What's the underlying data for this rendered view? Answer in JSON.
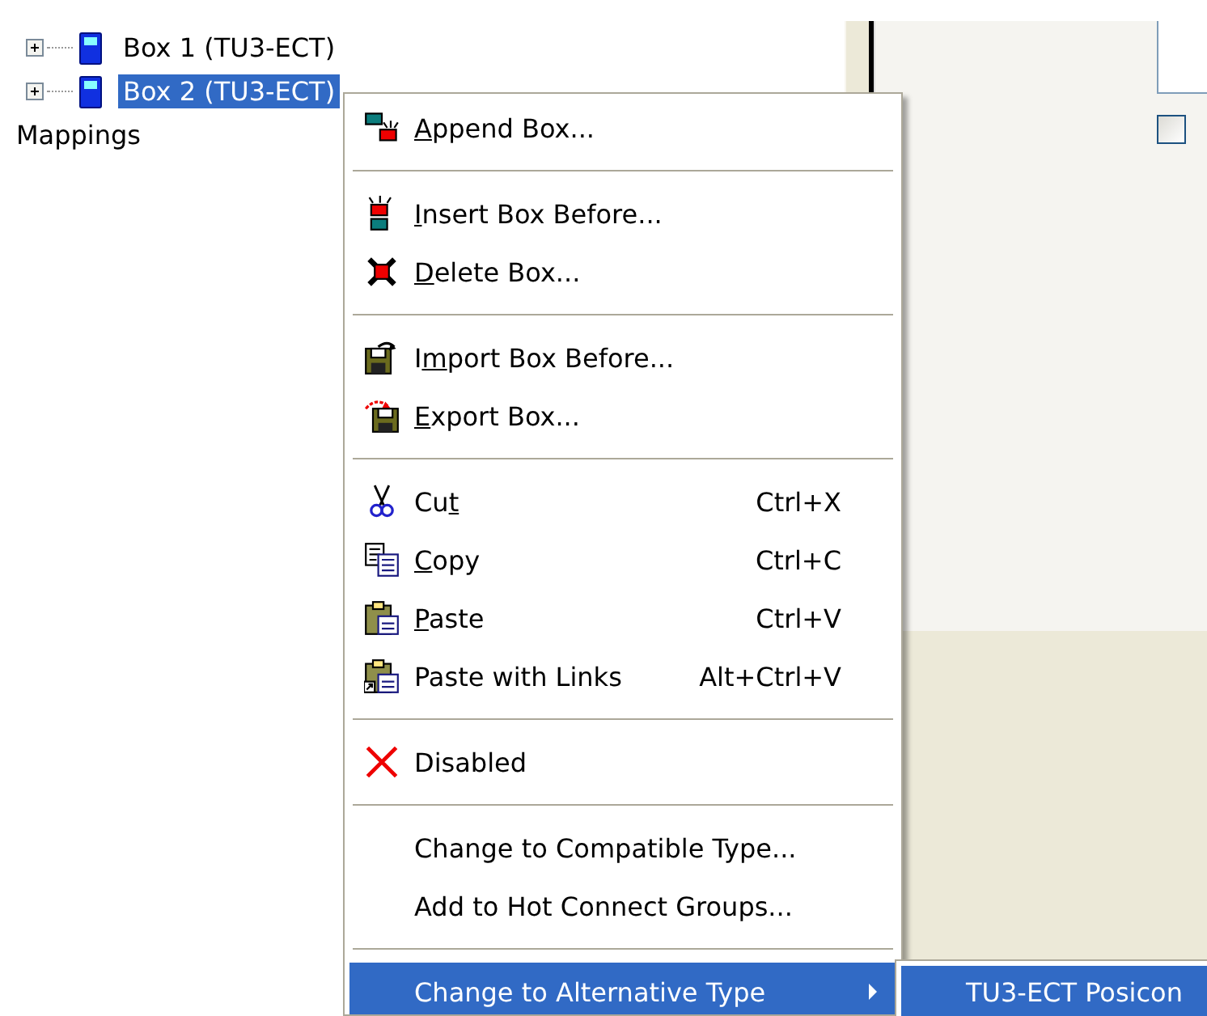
{
  "tree": {
    "items": [
      {
        "label": "Box 1 (TU3-ECT)",
        "expanded": false,
        "selected": false
      },
      {
        "label": "Box 2 (TU3-ECT)",
        "expanded": false,
        "selected": true
      }
    ],
    "footer_label": "Mappings"
  },
  "right_panel": {
    "checkbox": {
      "checked": false
    }
  },
  "context_menu": {
    "items": [
      {
        "kind": "item",
        "label": {
          "key": "A",
          "after": "ppend Box..."
        },
        "selected": false
      },
      {
        "kind": "separator"
      },
      {
        "kind": "item",
        "label": {
          "key": "I",
          "after": "nsert Box Before..."
        },
        "selected": false
      },
      {
        "kind": "item",
        "label": {
          "key": "D",
          "after": "elete Box..."
        },
        "selected": false
      },
      {
        "kind": "separator"
      },
      {
        "kind": "item",
        "label": {
          "before": "I",
          "key": "m",
          "after": "port Box Before..."
        },
        "selected": false
      },
      {
        "kind": "item",
        "label": {
          "key": "E",
          "after": "xport Box..."
        },
        "selected": false
      },
      {
        "kind": "separator"
      },
      {
        "kind": "item",
        "label": {
          "before": "Cu",
          "key": "t"
        },
        "shortcut": "Ctrl+X",
        "selected": false
      },
      {
        "kind": "item",
        "label": {
          "key": "C",
          "after": "opy"
        },
        "shortcut": "Ctrl+C",
        "selected": false
      },
      {
        "kind": "item",
        "label": {
          "key": "P",
          "after": "aste"
        },
        "shortcut": "Ctrl+V",
        "selected": false
      },
      {
        "kind": "item",
        "label": {
          "before": "Paste with Links"
        },
        "shortcut": "Alt+Ctrl+V",
        "selected": false
      },
      {
        "kind": "separator"
      },
      {
        "kind": "item",
        "label": {
          "before": "Disabled"
        },
        "selected": false
      },
      {
        "kind": "separator"
      },
      {
        "kind": "item",
        "label": {
          "before": "Change to Compatible Type..."
        },
        "selected": false
      },
      {
        "kind": "item",
        "label": {
          "before": "Add to Hot Connect Groups..."
        },
        "selected": false
      },
      {
        "kind": "separator"
      },
      {
        "kind": "item",
        "label": {
          "before": "Change to Alternative Type"
        },
        "selected": true,
        "has_submenu": true
      }
    ]
  },
  "submenu": {
    "items": [
      {
        "label": "TU3-ECT Posicon",
        "selected": true
      }
    ]
  }
}
